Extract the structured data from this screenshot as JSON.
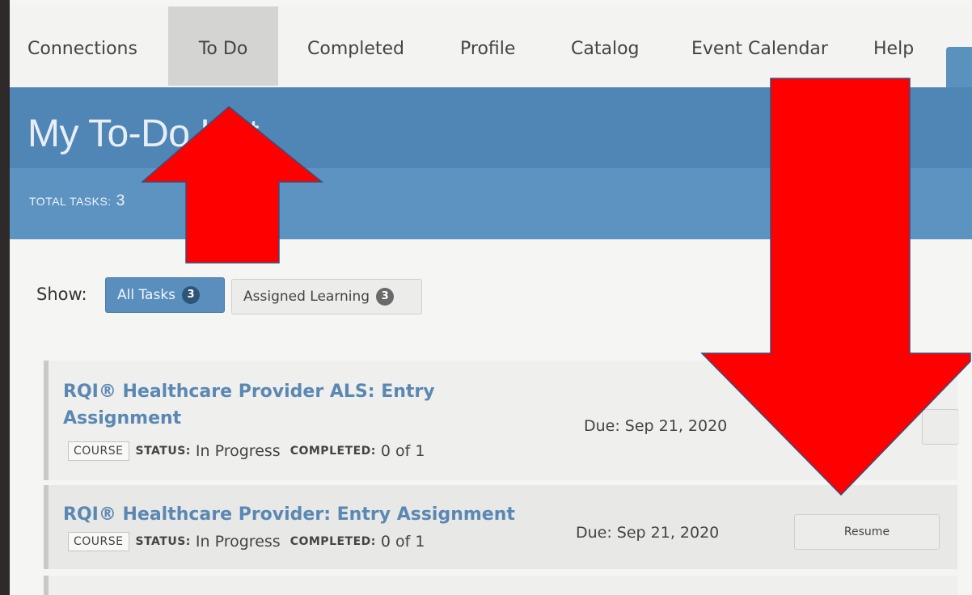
{
  "nav": {
    "tabs": [
      {
        "label": "Connections"
      },
      {
        "label": "To Do"
      },
      {
        "label": "Completed"
      },
      {
        "label": "Profile"
      },
      {
        "label": "Catalog"
      },
      {
        "label": "Event Calendar"
      },
      {
        "label": "Help"
      }
    ],
    "active_tab": "To Do"
  },
  "page": {
    "title": "My To-Do List",
    "total_label": "TOTAL TASKS:",
    "total_value": "3"
  },
  "filters": {
    "show_label": "Show:",
    "items": [
      {
        "label": "All Tasks",
        "count": "3",
        "active": true
      },
      {
        "label": "Assigned Learning",
        "count": "3",
        "active": false
      }
    ]
  },
  "tasks": [
    {
      "title_line1": "RQI® Healthcare Provider ALS: Entry",
      "title_line2": "Assignment",
      "type": "COURSE",
      "status_label": "STATUS:",
      "status": "In Progress",
      "completed_label": "COMPLETED:",
      "completed": "0 of 1",
      "due": "Due: Sep 21, 2020"
    },
    {
      "title_line1": "RQI® Healthcare Provider: Entry Assignment",
      "type": "COURSE",
      "status_label": "STATUS:",
      "status": "In Progress",
      "completed_label": "COMPLETED:",
      "completed": "0 of 1",
      "due": "Due: Sep 21, 2020",
      "action": "Resume"
    }
  ],
  "colors": {
    "accent": "#4f86b5",
    "arrow": "#ff0000",
    "link": "#5a88b3"
  },
  "annotations": [
    {
      "icon": "red-up-arrow-icon"
    },
    {
      "icon": "red-down-arrow-icon"
    }
  ]
}
